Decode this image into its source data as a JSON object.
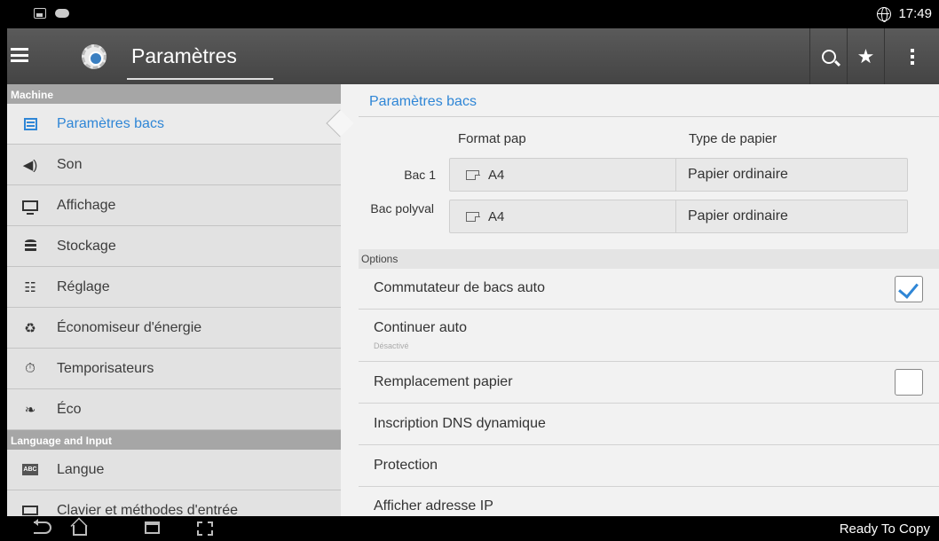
{
  "status_bar": {
    "time": "17:49"
  },
  "action_bar": {
    "title": "Paramètres"
  },
  "sidebar": {
    "sections": [
      {
        "header": "Machine",
        "items": [
          {
            "label": "Paramètres bacs",
            "icon": "tray-icon",
            "active": true
          },
          {
            "label": "Son",
            "icon": "speaker-icon"
          },
          {
            "label": "Affichage",
            "icon": "monitor-icon"
          },
          {
            "label": "Stockage",
            "icon": "storage-icon"
          },
          {
            "label": "Réglage",
            "icon": "sliders-icon"
          },
          {
            "label": "Économiseur d'énergie",
            "icon": "recycle-icon"
          },
          {
            "label": "Temporisateurs",
            "icon": "stopwatch-icon"
          },
          {
            "label": "Éco",
            "icon": "leaf-icon"
          }
        ]
      },
      {
        "header": "Language and Input",
        "items": [
          {
            "label": "Langue",
            "icon": "abc-icon"
          },
          {
            "label": "Clavier et méthodes d'entrée",
            "icon": "keyboard-icon"
          }
        ]
      }
    ]
  },
  "main": {
    "title": "Paramètres bacs",
    "col_format": "Format pap",
    "col_type": "Type de papier",
    "trays": [
      {
        "label": "Bac 1",
        "format": "A4",
        "type": "Papier ordinaire"
      },
      {
        "label": "Bac polyval",
        "format": "A4",
        "type": "Papier ordinaire"
      }
    ],
    "options_header": "Options",
    "options": [
      {
        "label": "Commutateur de bacs auto",
        "checkbox": true,
        "checked": true
      },
      {
        "label": "Continuer auto",
        "sub": "Désactivé"
      },
      {
        "label": "Remplacement papier",
        "checkbox": true,
        "checked": false
      },
      {
        "label": "Inscription DNS dynamique"
      },
      {
        "label": "Protection"
      },
      {
        "label": "Afficher adresse IP"
      }
    ]
  },
  "nav_bar": {
    "status": "Ready To Copy"
  },
  "colors": {
    "accent": "#2f86d6",
    "action_bar": "#4f4f4f",
    "sidebar_bg": "#e2e2e2",
    "section_header": "#a6a6a6"
  }
}
